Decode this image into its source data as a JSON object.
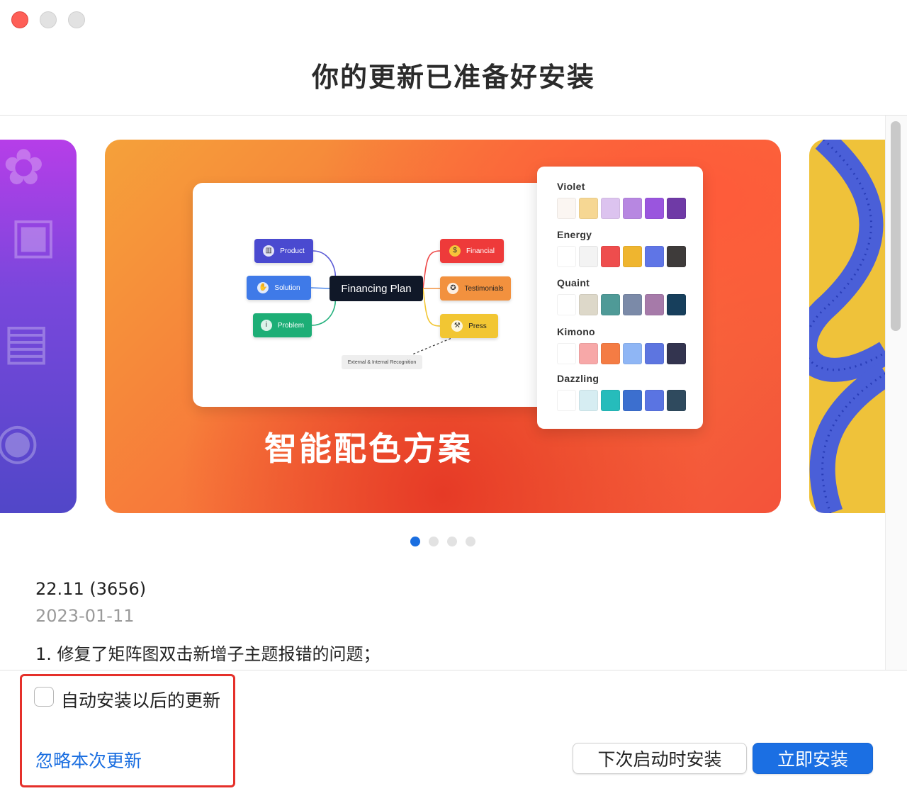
{
  "window": {
    "title": "你的更新已准备好安装"
  },
  "carousel": {
    "current_caption": "智能配色方案",
    "mindmap": {
      "center": "Financing Plan",
      "left_nodes": [
        {
          "label": "Product",
          "icon": "chart-icon",
          "color": "#4a4ad0"
        },
        {
          "label": "Solution",
          "icon": "handshake-icon",
          "color": "#3f7ae8"
        },
        {
          "label": "Problem",
          "icon": "info-icon",
          "color": "#1dae76"
        }
      ],
      "right_nodes": [
        {
          "label": "Financial",
          "icon": "dollar-icon",
          "color": "#ee3a3a"
        },
        {
          "label": "Testimonials",
          "icon": "medal-icon",
          "color": "#f2913e"
        },
        {
          "label": "Press",
          "icon": "gavel-icon",
          "color": "#f2c633"
        }
      ],
      "external": "External & Internal Recognition"
    },
    "palettes": [
      {
        "name": "Violet",
        "colors": [
          "#fbf6f2",
          "#f6d793",
          "#dcc3ef",
          "#b787e1",
          "#9a55de",
          "#6f3aa6"
        ]
      },
      {
        "name": "Energy",
        "colors": [
          "#ffffff",
          "#f3f3f3",
          "#ee4d4d",
          "#efb52f",
          "#5f75e6",
          "#3e3b3a"
        ]
      },
      {
        "name": "Quaint",
        "colors": [
          "#ffffff",
          "#ddd8c9",
          "#4f9a97",
          "#7b8aa8",
          "#a67aa9",
          "#173f5c"
        ]
      },
      {
        "name": "Kimono",
        "colors": [
          "#ffffff",
          "#f7a8a8",
          "#f47c44",
          "#8fb6f5",
          "#5d75e0",
          "#33344f"
        ]
      },
      {
        "name": "Dazzling",
        "colors": [
          "#ffffff",
          "#d6edf2",
          "#26bcbb",
          "#3c6fcf",
          "#5a74e2",
          "#2f4a5e"
        ]
      }
    ],
    "page_count": 4,
    "active_page": 1
  },
  "release_notes": {
    "version": "22.11 (3656)",
    "date": "2023-01-11",
    "items": [
      "1. 修复了矩阵图双击新增子主题报错的问题；"
    ]
  },
  "footer": {
    "auto_install_label": "自动安装以后的更新",
    "auto_install_checked": false,
    "ignore_label": "忽略本次更新",
    "install_later_label": "下次启动时安装",
    "install_now_label": "立即安装"
  },
  "colors": {
    "accent": "#1b6fe3",
    "highlight_border": "#e5302a"
  }
}
